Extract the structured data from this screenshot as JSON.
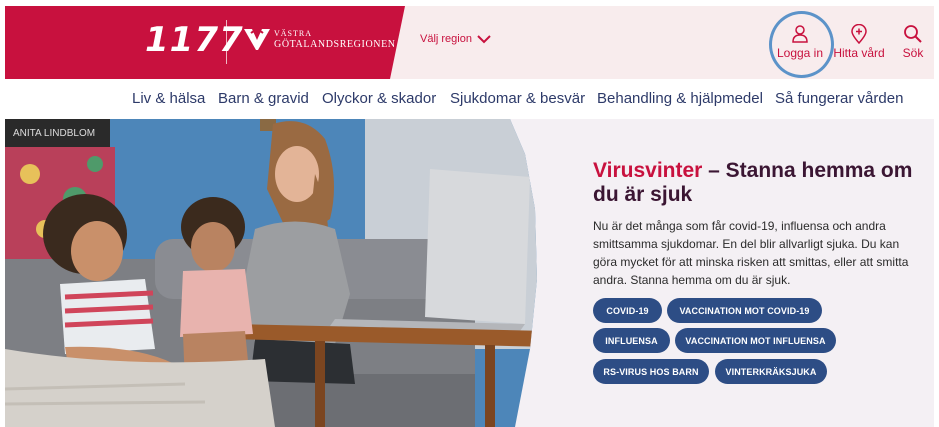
{
  "header": {
    "logo_1177": "1177",
    "vgr_line1": "VÄSTRA",
    "vgr_line2": "GÖTALANDSREGIONEN",
    "region_select": "Välj region",
    "login": "Logga in",
    "find_care": "Hitta vård",
    "search": "Sök",
    "colors": {
      "brand": "#c8113e",
      "header_bg": "#f8eced",
      "highlight_ring": "#5c93c9"
    }
  },
  "nav": {
    "items": [
      "Liv & hälsa",
      "Barn & gravid",
      "Olyckor & skador",
      "Sjukdomar & besvär",
      "Behandling & hjälpmedel",
      "Så fungerar vården"
    ]
  },
  "hero": {
    "title_highlight": "Virusvinter",
    "title_rest": " – Stanna hemma om du är sjuk",
    "body": "Nu är det många som får covid-19, influensa och andra smittsamma sjukdomar. En del blir allvarligt sjuka. Du kan göra mycket för att minska risken att smittas, eller att smitta andra. Stanna hemma om du är sjuk.",
    "photo_poster_text": "ANITA LINDBLOM",
    "tags": [
      "COVID-19",
      "VACCINATION MOT COVID-19",
      "INFLUENSA",
      "VACCINATION MOT INFLUENSA",
      "RS-VIRUS HOS BARN",
      "VINTERKRÄKSJUKA"
    ],
    "colors": {
      "tag_bg": "#2d4d85",
      "title": "#3b1633"
    }
  }
}
